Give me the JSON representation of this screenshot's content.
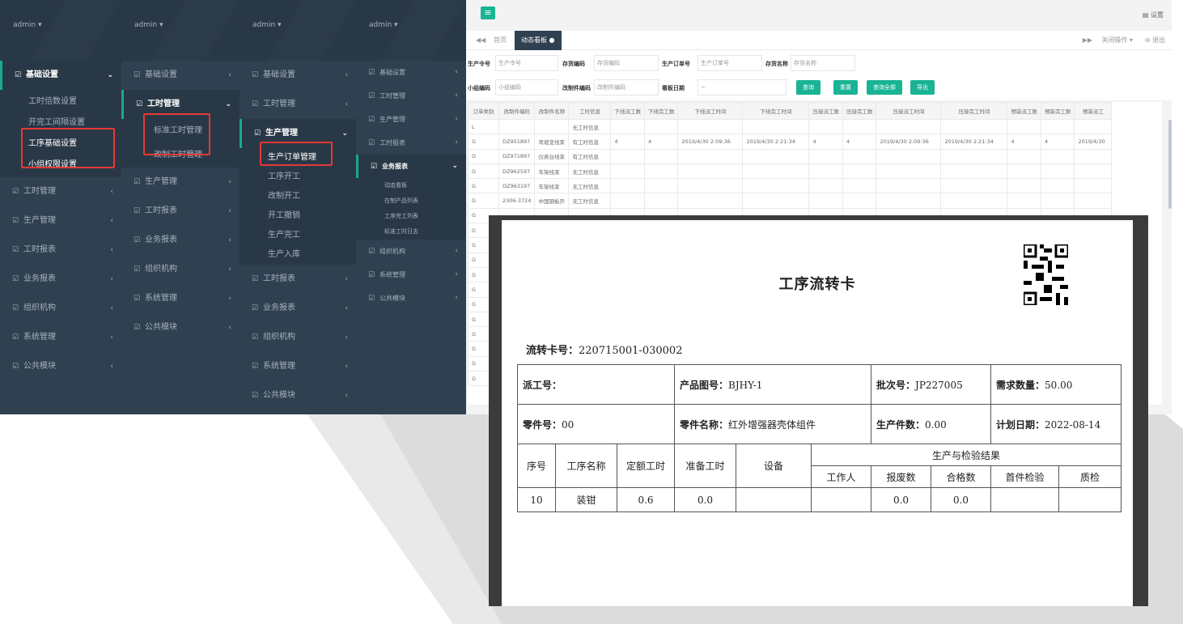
{
  "panel1": {
    "user": "admin ▾",
    "items": [
      {
        "label": "基础设置",
        "expanded": true,
        "subs": [
          "工时倍数设置",
          "开完工间隔设置",
          "工序基础设置",
          "小组权限设置"
        ]
      },
      {
        "label": "工时管理"
      },
      {
        "label": "生产管理"
      },
      {
        "label": "工时报表"
      },
      {
        "label": "业务报表"
      },
      {
        "label": "组织机构"
      },
      {
        "label": "系统管理"
      },
      {
        "label": "公共模块"
      }
    ]
  },
  "panel2": {
    "user": "admin ▾",
    "items": [
      {
        "label": "基础设置"
      },
      {
        "label": "工时管理",
        "expanded": true,
        "subs": [
          "标准工时管理",
          "改制工时管理"
        ]
      },
      {
        "label": "生产管理"
      },
      {
        "label": "工时报表"
      },
      {
        "label": "业务报表"
      },
      {
        "label": "组织机构"
      },
      {
        "label": "系统管理"
      },
      {
        "label": "公共模块"
      }
    ]
  },
  "panel3": {
    "user": "admin ▾",
    "items": [
      {
        "label": "基础设置"
      },
      {
        "label": "工时管理"
      },
      {
        "label": "生产管理",
        "expanded": true,
        "subs": [
          "生产订单管理",
          "工序开工",
          "改制开工",
          "开工撤销",
          "生产完工",
          "生产入库"
        ]
      },
      {
        "label": "工时报表"
      },
      {
        "label": "业务报表"
      },
      {
        "label": "组织机构"
      },
      {
        "label": "系统管理"
      },
      {
        "label": "公共模块"
      }
    ]
  },
  "panel4": {
    "user": "admin ▾",
    "items": [
      {
        "label": "基础设置"
      },
      {
        "label": "工时管理"
      },
      {
        "label": "生产管理"
      },
      {
        "label": "工时报表"
      },
      {
        "label": "业务报表",
        "expanded": true,
        "subs": [
          "动态看板",
          "在制产品列表",
          "工序完工列表",
          "标准工时日志"
        ]
      },
      {
        "label": "组织机构"
      },
      {
        "label": "系统管理"
      },
      {
        "label": "公共模块"
      }
    ]
  },
  "main": {
    "menu_icon": "≡",
    "settings": "▤ 设置",
    "tabs": {
      "back": "◀◀",
      "home": "首页",
      "active": "动态看板 ●",
      "forward": "▶▶",
      "close_ops": "关闭操作 ▾",
      "logout": "⊖ 退出"
    },
    "filters": {
      "l1": "生产令号",
      "p1": "生产令号",
      "l2": "存货编码",
      "p2": "存货编码",
      "l3": "生产订单号",
      "p3": "生产订单号",
      "l4": "存货名称",
      "p4": "存货名称",
      "l5": "小组编码",
      "p5": "小组编码",
      "l6": "改制件编码",
      "p6": "改制件编码",
      "l7": "看板日期",
      "p7": "~"
    },
    "buttons": {
      "query": "查询",
      "reset": "重置",
      "query_all": "查询全部",
      "export": "导出"
    },
    "grid_headers": [
      "订单类别",
      "改制件编码",
      "改制件名称",
      "工时信息",
      "下线派工数",
      "下线完工数",
      "下线派工时间",
      "下线完工时间",
      "压接派工数",
      "压接完工数",
      "压接派工时间",
      "压接完工时间",
      "预装派工数",
      "预装完工数",
      "预装派工"
    ],
    "grid_rows": [
      [
        "L",
        "",
        "",
        "无工时信息",
        "",
        "",
        "",
        "",
        "",
        "",
        "",
        "",
        "",
        "",
        ""
      ],
      [
        "G",
        "DZ951897",
        "弯坡变线束",
        "有工时信息",
        "4",
        "4",
        "2019/4/30 2:09:36",
        "2019/4/30 2:21:34",
        "4",
        "4",
        "2019/4/30 2:09:36",
        "2019/4/30 2:21:34",
        "4",
        "4",
        "2019/4/30"
      ],
      [
        "G",
        "DZ971897",
        "仪表台线束",
        "有工时信息",
        "",
        "",
        "",
        "",
        "",
        "",
        "",
        "",
        "",
        "",
        ""
      ],
      [
        "G",
        "DZ962597",
        "车架线束",
        "无工时信息",
        "",
        "",
        "",
        "",
        "",
        "",
        "",
        "",
        "",
        "",
        ""
      ],
      [
        "G",
        "DZ963197",
        "车架线束",
        "无工时信息",
        "",
        "",
        "",
        "",
        "",
        "",
        "",
        "",
        "",
        "",
        ""
      ],
      [
        "G",
        "2306-3724",
        "中国钢板开",
        "无工时信息",
        "",
        "",
        "",
        "",
        "",
        "",
        "",
        "",
        "",
        "",
        ""
      ],
      [
        "G",
        "",
        "",
        "",
        "",
        "",
        "",
        "",
        "",
        "",
        "",
        "",
        "",
        "",
        ""
      ],
      [
        "G",
        "",
        "",
        "",
        "",
        "",
        "",
        "",
        "",
        "",
        "",
        "",
        "",
        "",
        ""
      ],
      [
        "G",
        "",
        "",
        "",
        "",
        "",
        "",
        "",
        "",
        "",
        "",
        "",
        "",
        "",
        ""
      ],
      [
        "G",
        "",
        "",
        "",
        "",
        "",
        "",
        "",
        "",
        "",
        "",
        "",
        "",
        "",
        ""
      ],
      [
        "G",
        "",
        "",
        "",
        "",
        "",
        "",
        "",
        "",
        "",
        "",
        "",
        "",
        "",
        ""
      ],
      [
        "G",
        "",
        "",
        "",
        "",
        "",
        "",
        "",
        "",
        "",
        "",
        "",
        "",
        "",
        ""
      ],
      [
        "G",
        "",
        "",
        "",
        "",
        "",
        "",
        "",
        "",
        "",
        "",
        "",
        "",
        "",
        ""
      ],
      [
        "G",
        "",
        "",
        "",
        "",
        "",
        "",
        "",
        "",
        "",
        "",
        "",
        "",
        "",
        ""
      ],
      [
        "G",
        "",
        "",
        "",
        "",
        "",
        "",
        "",
        "",
        "",
        "",
        "",
        "",
        "",
        ""
      ],
      [
        "G",
        "",
        "",
        "",
        "",
        "",
        "",
        "",
        "",
        "",
        "",
        "",
        "",
        "",
        ""
      ],
      [
        "G",
        "",
        "",
        "",
        "",
        "",
        "",
        "",
        "",
        "",
        "",
        "",
        "",
        "",
        ""
      ],
      [
        "G",
        "",
        "",
        "",
        "",
        "",
        "",
        "",
        "",
        "",
        "",
        "",
        "",
        "",
        ""
      ]
    ]
  },
  "card": {
    "title": "工序流转卡",
    "flow_label": "流转卡号：",
    "flow_no": "220715001-030002",
    "r1": [
      {
        "k": "派工号：",
        "v": ""
      },
      {
        "k": "产品图号：",
        "v": "BJHY-1"
      },
      {
        "k": "批次号：",
        "v": "JP227005"
      },
      {
        "k": "需求数量：",
        "v": "50.00"
      }
    ],
    "r2": [
      {
        "k": "零件号：",
        "v": "00"
      },
      {
        "k": "零件名称：",
        "v": "红外增强器壳体组件"
      },
      {
        "k": "生产件数：",
        "v": "0.00"
      },
      {
        "k": "计划日期：",
        "v": "2022-08-14"
      }
    ],
    "h1": [
      "序号",
      "工序名称",
      "定额工时",
      "准备工时",
      "设备",
      "生产与检验结果"
    ],
    "h2": [
      "工作人",
      "报废数",
      "合格数",
      "首件检验",
      "质检"
    ],
    "row": [
      "10",
      "装钳",
      "0.6",
      "0.0",
      "",
      "",
      "0.0",
      "0.0",
      "",
      ""
    ]
  },
  "colors": {
    "sidebar": "#2f4050",
    "accent": "#1ab394",
    "highlight": "#e53935"
  }
}
